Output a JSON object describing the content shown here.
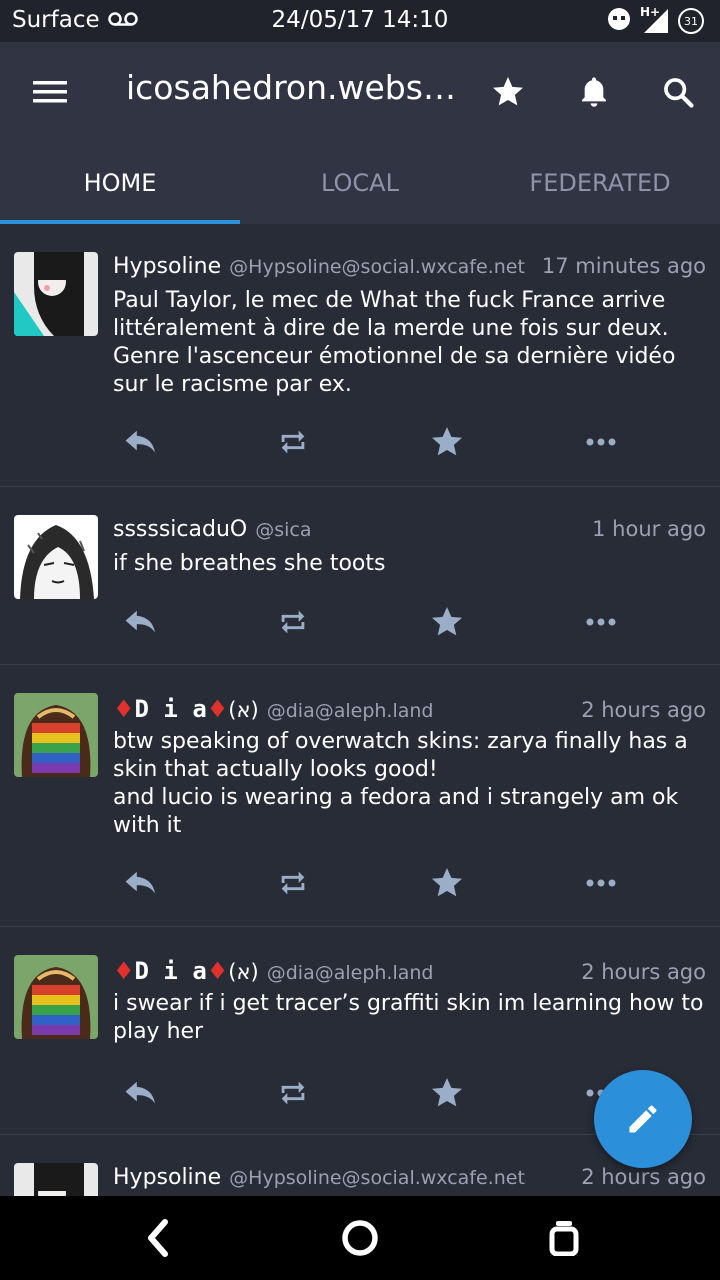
{
  "statusbar": {
    "carrier": "Surface",
    "datetime": "24/05/17 14:10",
    "network_label": "H+",
    "battery": "31"
  },
  "appbar": {
    "title": "icosahedron.webs…"
  },
  "tabs": [
    {
      "label": "HOME",
      "active": true
    },
    {
      "label": "LOCAL",
      "active": false
    },
    {
      "label": "FEDERATED",
      "active": false
    }
  ],
  "feed": [
    {
      "display_name": "Hypsoline",
      "acct": "@Hypsoline@social.wxcafe.net",
      "time": "17 minutes ago",
      "content": "Paul Taylor, le mec de What the fuck France arrive\nlittéralement à dire de la merde une fois sur deux.\nGenre l'ascenceur émotionnel de sa dernière vidéo\nsur le racisme par ex."
    },
    {
      "display_name": "sssssicaduO",
      "acct": "@sica",
      "time": "1 hour ago",
      "content": "if she breathes she toots"
    },
    {
      "display_name_left": "♦",
      "display_name_mid": "D i a",
      "display_name_right": "♦",
      "display_name_suffix": "(א)",
      "acct": "@dia@aleph.land",
      "time": "2 hours ago",
      "content": "btw speaking of overwatch skins: zarya finally has a\nskin that actually looks good!\nand lucio is wearing a fedora and i strangely am ok\nwith it"
    },
    {
      "display_name_left": "♦",
      "display_name_mid": "D i a",
      "display_name_right": "♦",
      "display_name_suffix": "(א)",
      "acct": "@dia@aleph.land",
      "time": "2 hours ago",
      "content": "i swear if i get tracer’s graffiti skin im learning how to\nplay her"
    },
    {
      "display_name": "Hypsoline",
      "acct": "@Hypsoline@social.wxcafe.net",
      "time": "2 hours ago"
    }
  ],
  "colors": {
    "background": "#282c37",
    "appbar": "#313543",
    "accent": "#2b90d9",
    "muted_text": "#9ba0b2",
    "icon": "#9baec8"
  }
}
